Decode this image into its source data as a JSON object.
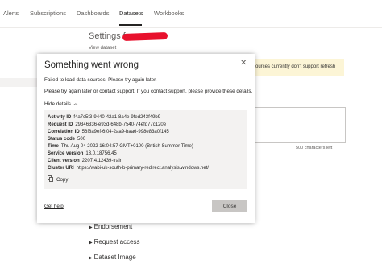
{
  "nav": {
    "tabs": [
      {
        "label": "Alerts"
      },
      {
        "label": "Subscriptions"
      },
      {
        "label": "Dashboards"
      },
      {
        "label": "Datasets"
      },
      {
        "label": "Workbooks"
      }
    ],
    "active_tab": "Datasets"
  },
  "background": {
    "settings_title": "Settings fo",
    "view_dataset": "View dataset",
    "warning_text": "sources currently don't support refresh",
    "char_count": "500 characters left",
    "sections": [
      "Endorsement",
      "Request access",
      "Dataset Image"
    ]
  },
  "dialog": {
    "title": "Something went wrong",
    "message": "Failed to load data sources. Please try again later.",
    "support_message": "Please try again later or contact support. If you contact support, please provide these details.",
    "hide_details": "Hide details",
    "details": [
      {
        "label": "Activity ID",
        "value": "f4a7c5f3-9440-42a1-8a4e-9fed243f49b9"
      },
      {
        "label": "Request ID",
        "value": "29346336-e93d-648b-7540-74efd77c120e"
      },
      {
        "label": "Correlation ID",
        "value": "56f8a9ef-6f04-2aa9-baa6-998e83a0f145"
      },
      {
        "label": "Status code",
        "value": "500"
      },
      {
        "label": "Time",
        "value": "Thu Aug 04 2022 16:04:57 GMT+0100 (British Summer Time)"
      },
      {
        "label": "Service version",
        "value": "13.0.18756.45"
      },
      {
        "label": "Client version",
        "value": "2207.4.12439-train"
      },
      {
        "label": "Cluster URI",
        "value": "https://wabi-uk-south-b-primary-redirect.analysis.windows.net/"
      }
    ],
    "copy_label": "Copy",
    "get_help_label": "Get help",
    "close_label": "Close"
  },
  "colors": {
    "redaction": "#e8112d",
    "warning_bg": "#fcf5d6",
    "details_bg": "#f3f2f1",
    "close_button_bg": "#c8c6c4"
  }
}
